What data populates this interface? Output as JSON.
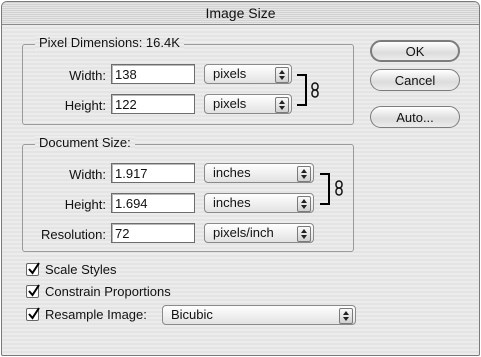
{
  "window": {
    "title": "Image Size"
  },
  "pixel_dimensions": {
    "legend": "Pixel Dimensions:  16.4K",
    "width_label": "Width:",
    "width_value": "138",
    "width_unit": "pixels",
    "height_label": "Height:",
    "height_value": "122",
    "height_unit": "pixels"
  },
  "document_size": {
    "legend": "Document Size:",
    "width_label": "Width:",
    "width_value": "1.917",
    "width_unit": "inches",
    "height_label": "Height:",
    "height_value": "1.694",
    "height_unit": "inches",
    "resolution_label": "Resolution:",
    "resolution_value": "72",
    "resolution_unit": "pixels/inch"
  },
  "buttons": {
    "ok": "OK",
    "cancel": "Cancel",
    "auto": "Auto..."
  },
  "options": {
    "scale_styles": {
      "label": "Scale Styles",
      "checked": true
    },
    "constrain_proportions": {
      "label": "Constrain Proportions",
      "checked": true
    },
    "resample_image": {
      "label": "Resample Image:",
      "checked": true,
      "method": "Bicubic"
    }
  }
}
